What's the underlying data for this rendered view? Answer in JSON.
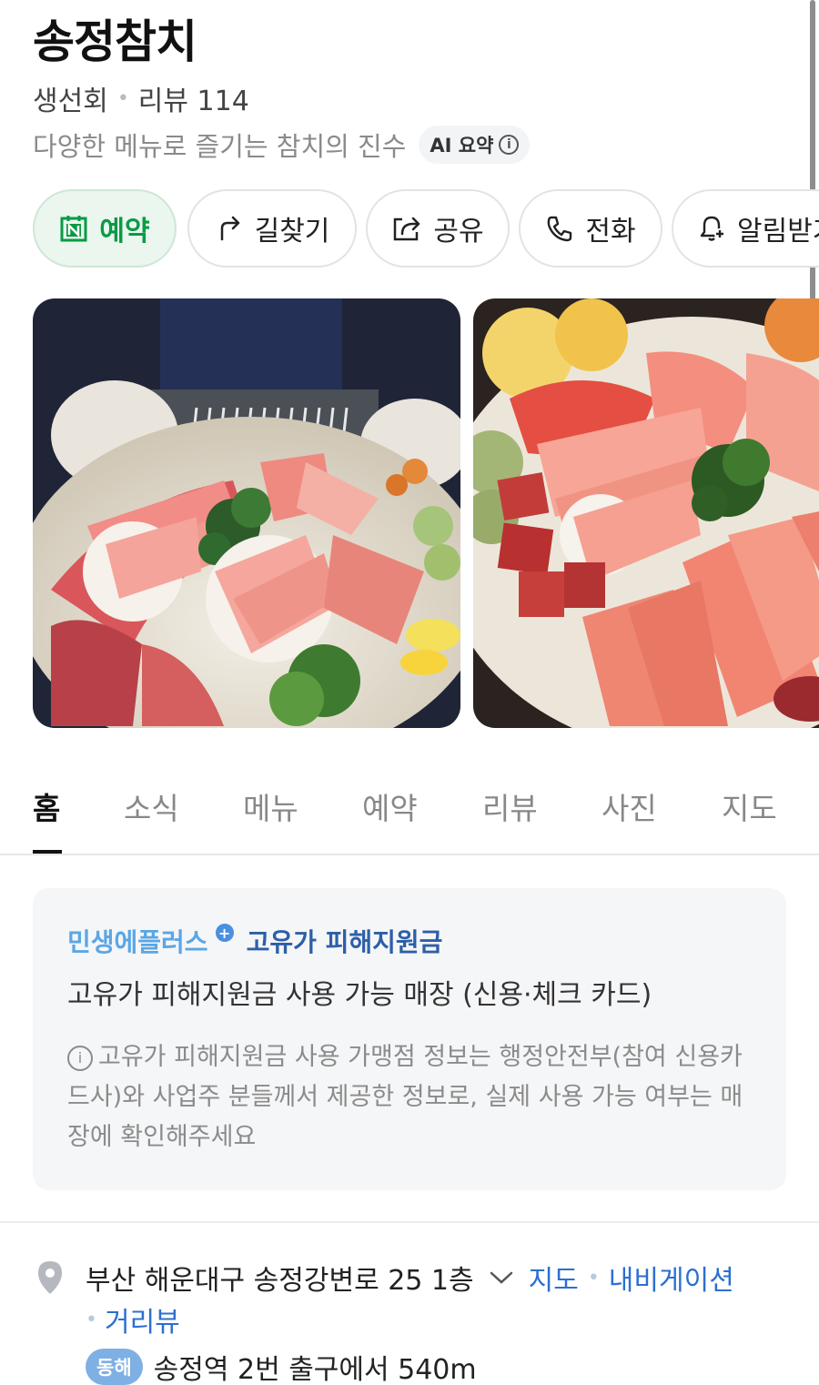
{
  "place": {
    "name": "송정참치",
    "category": "생선회",
    "review_label": "리뷰 114",
    "description": "다양한 메뉴로 즐기는 참치의 진수",
    "ai_summary_label": "AI 요약"
  },
  "actions": [
    {
      "label": "예약",
      "icon": "naver-reserve-icon"
    },
    {
      "label": "길찾기",
      "icon": "directions-icon"
    },
    {
      "label": "공유",
      "icon": "share-icon"
    },
    {
      "label": "전화",
      "icon": "phone-icon"
    },
    {
      "label": "알림받기",
      "icon": "bell-plus-icon"
    }
  ],
  "photos": [
    "tuna-platter-photo-1",
    "tuna-platter-photo-2"
  ],
  "tabs": [
    {
      "label": "홈",
      "active": true
    },
    {
      "label": "소식"
    },
    {
      "label": "메뉴"
    },
    {
      "label": "예약"
    },
    {
      "label": "리뷰"
    },
    {
      "label": "사진"
    },
    {
      "label": "지도"
    }
  ],
  "promo": {
    "brand": "민생에플러스",
    "program": "고유가 피해지원금",
    "main": "고유가 피해지원금 사용 가능 매장 (신용·체크 카드)",
    "note": "고유가 피해지원금 사용 가맹점 정보는 행정안전부(참여 신용카드사)와 사업주 분들께서 제공한 정보로, 실제 사용 가능 여부는 매장에 확인해주세요"
  },
  "address": {
    "text": "부산 해운대구 송정강변로 25 1층",
    "links": [
      "지도",
      "내비게이션",
      "거리뷰"
    ],
    "subway_line": "동해",
    "subway_text": "송정역 2번 출구에서 540m"
  },
  "colors": {
    "reserve_green": "#0a9a45",
    "link_blue": "#2c6fd1",
    "line_badge": "#7fb0e4"
  }
}
